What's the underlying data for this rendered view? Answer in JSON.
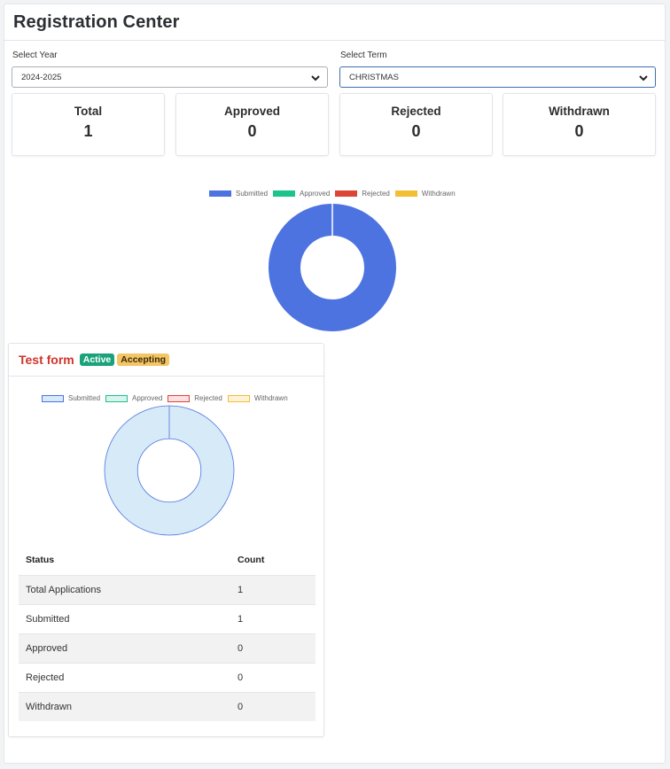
{
  "header": {
    "title": "Registration Center"
  },
  "filters": {
    "year": {
      "label": "Select Year",
      "value": "2024-2025"
    },
    "term": {
      "label": "Select Term",
      "value": "CHRISTMAS"
    }
  },
  "stats": [
    {
      "label": "Total",
      "value": "1"
    },
    {
      "label": "Approved",
      "value": "0"
    },
    {
      "label": "Rejected",
      "value": "0"
    },
    {
      "label": "Withdrawn",
      "value": "0"
    }
  ],
  "colors": {
    "submitted": "#4d73e0",
    "approved": "#1bc48a",
    "rejected": "#dc4437",
    "withdrawn": "#f2bf34",
    "submitted_light": "#d6eaf8",
    "approved_light": "#d9f3ef",
    "rejected_light": "#fde0e4",
    "withdrawn_light": "#fff1d6"
  },
  "chart_data": [
    {
      "type": "pie",
      "categories": [
        "Submitted",
        "Approved",
        "Rejected",
        "Withdrawn"
      ],
      "values": [
        1,
        0,
        0,
        0
      ],
      "legend": "top"
    },
    {
      "type": "pie",
      "categories": [
        "Submitted",
        "Approved",
        "Rejected",
        "Withdrawn"
      ],
      "values": [
        1,
        0,
        0,
        0
      ],
      "legend": "top"
    }
  ],
  "form": {
    "title": "Test form",
    "badges": {
      "active": "Active",
      "accepting": "Accepting"
    },
    "table": {
      "headers": {
        "status": "Status",
        "count": "Count"
      },
      "rows": [
        {
          "status": "Total Applications",
          "count": "1"
        },
        {
          "status": "Submitted",
          "count": "1"
        },
        {
          "status": "Approved",
          "count": "0"
        },
        {
          "status": "Rejected",
          "count": "0"
        },
        {
          "status": "Withdrawn",
          "count": "0"
        }
      ]
    }
  }
}
